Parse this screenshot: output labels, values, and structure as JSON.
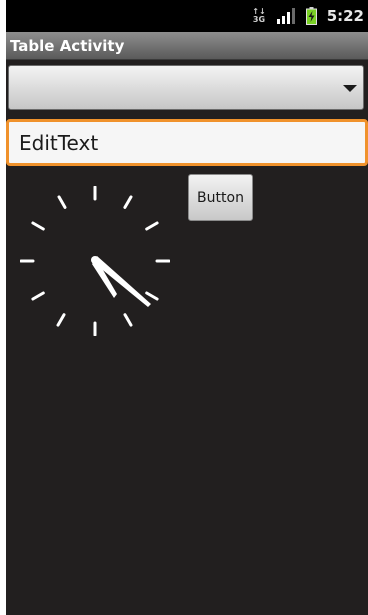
{
  "status_bar": {
    "network_label_top": "↑↓",
    "network_label_bottom": "3G",
    "time": "5:22",
    "icons": [
      "data-3g-icon",
      "signal-icon",
      "battery-charging-icon"
    ],
    "battery_color": "#7ad125"
  },
  "title_bar": {
    "title": "Table Activity"
  },
  "spinner": {
    "selected_value": ""
  },
  "edit_text": {
    "value": "EditText"
  },
  "button": {
    "label": "Button"
  },
  "analog_clock": {
    "hour": 5,
    "minute": 22
  },
  "colors": {
    "background": "#221f1f",
    "edit_focus_border": "#f0922c"
  }
}
